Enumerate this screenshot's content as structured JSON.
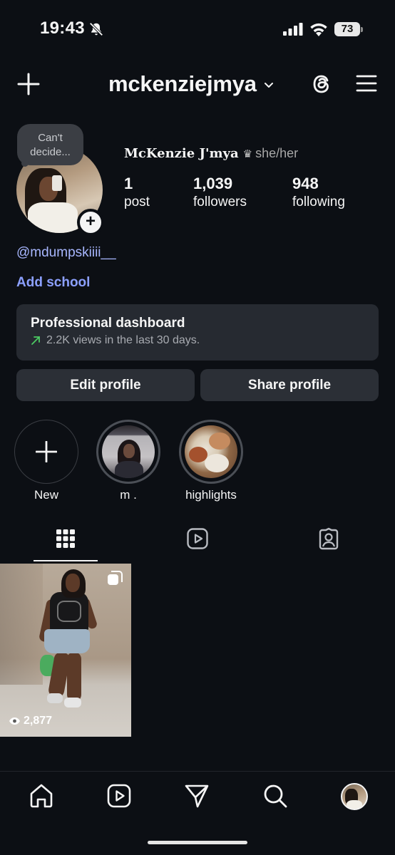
{
  "status_bar": {
    "time": "19:43",
    "battery": "73"
  },
  "header": {
    "username": "mckenziejmya"
  },
  "profile": {
    "note": "Can't decide...",
    "full_name": "McKenzie J'mya",
    "crown": "♛",
    "pronouns": "she/her",
    "stats": [
      {
        "value": "1",
        "label": "post"
      },
      {
        "value": "1,039",
        "label": "followers"
      },
      {
        "value": "948",
        "label": "following"
      }
    ],
    "threads_handle": "@mdumpskiiii__",
    "add_school": "Add school"
  },
  "dashboard": {
    "title": "Professional dashboard",
    "subtitle": "2.2K views in the last 30 days."
  },
  "buttons": {
    "edit": "Edit profile",
    "share": "Share profile"
  },
  "highlights": [
    {
      "label": "New"
    },
    {
      "label": "m ."
    },
    {
      "label": "highlights"
    }
  ],
  "post": {
    "views": "2,877"
  },
  "colors": {
    "background": "#0c0f14",
    "card": "#262a31",
    "button": "#2b2f36",
    "link": "#8ca0ff",
    "trend": "#4ccb63"
  },
  "icons": {
    "header": [
      "plus-icon",
      "chevron-down-icon",
      "threads-icon",
      "menu-icon"
    ],
    "tabs": [
      "grid-icon",
      "reels-icon",
      "tagged-icon"
    ],
    "nav": [
      "home-icon",
      "reels-icon",
      "send-icon",
      "search-icon",
      "profile-avatar"
    ]
  }
}
